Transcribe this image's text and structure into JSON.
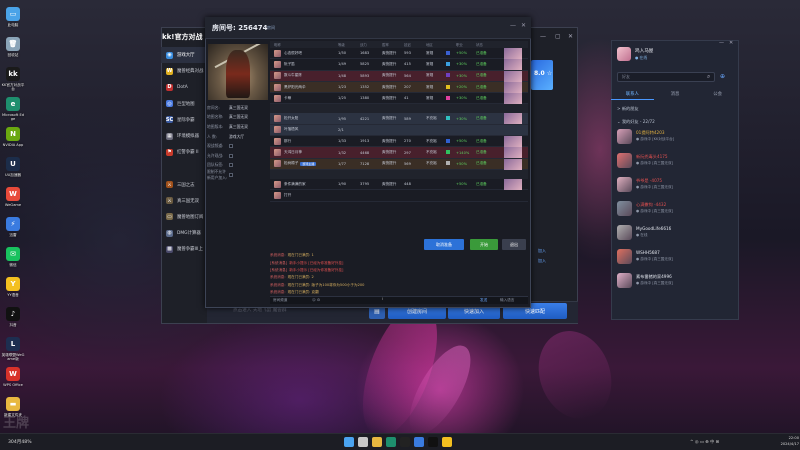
{
  "desktop": {
    "icons": [
      {
        "label": "此电脑",
        "color": "#4aa3e8",
        "glyph": "▭"
      },
      {
        "label": "回收站",
        "color": "#8aa4b8",
        "glyph": "🗑"
      },
      {
        "label": "KK官方对战平台",
        "color": "#1a1a1a",
        "glyph": "kk"
      },
      {
        "label": "Microsoft Edge",
        "color": "#1e8f6e",
        "glyph": "e"
      },
      {
        "label": "NVIDIA App",
        "color": "#6aa810",
        "glyph": "N"
      },
      {
        "label": "UU加速器",
        "color": "#1c2d4a",
        "glyph": "U"
      },
      {
        "label": "WeGame",
        "color": "#e84a3a",
        "glyph": "W"
      },
      {
        "label": "迅雷",
        "color": "#3a7be0",
        "glyph": "⚡"
      },
      {
        "label": "微信",
        "color": "#19c25f",
        "glyph": "✉"
      },
      {
        "label": "YY语音",
        "color": "#f4c020",
        "glyph": "Y"
      },
      {
        "label": "抖音",
        "color": "#111111",
        "glyph": "♪"
      },
      {
        "label": "英雄联盟WeGame版",
        "color": "#1d2e50",
        "glyph": "L"
      },
      {
        "label": "WPS Office",
        "color": "#d8322a",
        "glyph": "W"
      },
      {
        "label": "新建文件夹",
        "color": "#e8b840",
        "glyph": "▬"
      }
    ],
    "watermark": "王牌"
  },
  "kk": {
    "logo": "kk!官方对战",
    "nav": [
      {
        "label": "游戏大厅",
        "color": "#3a8ee0",
        "glyph": "◉"
      },
      {
        "label": "魔兽经典对战",
        "color": "#e0b020",
        "glyph": "W"
      },
      {
        "label": "DotA",
        "color": "#c03030",
        "glyph": "D"
      },
      {
        "label": "巨型地图",
        "color": "#4a7ae0",
        "glyph": "◎"
      },
      {
        "label": "星际争霸",
        "color": "#3a5aa0",
        "glyph": "SC"
      },
      {
        "label": "环境模拟器",
        "color": "#6a6a7a",
        "glyph": "▦"
      },
      {
        "label": "红警争霸 II",
        "color": "#c83a2a",
        "glyph": "⚑"
      },
      {
        "label": "",
        "color": "#333",
        "glyph": ""
      },
      {
        "label": "三国之志",
        "color": "#a0501a",
        "glyph": "⚔"
      },
      {
        "label": "真三国无双",
        "color": "#6a5a40",
        "glyph": "⚔"
      },
      {
        "label": "魔兽地图订阅",
        "color": "#7a6a4a",
        "glyph": "▭"
      },
      {
        "label": "DMG计算器",
        "color": "#5a6a8a",
        "glyph": "◍"
      },
      {
        "label": "魔兽争霸III上",
        "color": "#4a4a6a",
        "glyph": "▩"
      }
    ],
    "search_placeholder": "点击进入 天地飞鼠 魔兽群",
    "btn_create": "创建房间",
    "btn_quick": "快速加入",
    "btn_match": "快速匹配",
    "right_labels": [
      "8.0 ☆",
      "加入",
      "加入"
    ]
  },
  "room": {
    "title": "房间号: 256474",
    "subtitle": "房间",
    "info": [
      {
        "k": "房间名:",
        "v": "真三国无双"
      },
      {
        "k": "地图名称:",
        "v": "真三国无双"
      },
      {
        "k": "地图版本:",
        "v": "真三国无双"
      },
      {
        "k": "人    数:",
        "v": "游戏大厅"
      },
      {
        "k": "观战频道:",
        "v": ""
      },
      {
        "k": "允许观战:",
        "v": ""
      },
      {
        "k": "团队标签:",
        "v": ""
      },
      {
        "k": "限制不允许新用户加入:",
        "v": ""
      }
    ],
    "columns": [
      "昵称",
      "等级",
      "战力",
      "胜率",
      "延迟",
      "地区",
      "",
      "职业",
      "状态",
      "",
      ""
    ],
    "team1_label": "",
    "team2_label": "",
    "players": [
      {
        "name": "心态很好吧",
        "tag": "",
        "a": "1/50",
        "b": "1683",
        "c": "爽快提升",
        "d": "593",
        "e": "常规",
        "col": "#3a60d0",
        "pct": "+50%",
        "stat": "已准备",
        "style": ""
      },
      {
        "name": "阮子笛",
        "tag": "",
        "a": "1/49",
        "b": "5825",
        "c": "爽快提升",
        "d": "415",
        "e": "常规",
        "col": "#3aa0e0",
        "pct": "+30%",
        "stat": "已准备",
        "style": ""
      },
      {
        "name": "数斗牛星陈",
        "tag": "",
        "a": "1/48",
        "b": "5893",
        "c": "爽快提升",
        "d": "564",
        "e": "常规",
        "col": "#7040c0",
        "pct": "+30%",
        "stat": "已准备",
        "style": "red"
      },
      {
        "name": "黑炉阳光两伞",
        "tag": "",
        "a": "1/23",
        "b": "1352",
        "c": "爽快提升",
        "d": "207",
        "e": "常规",
        "col": "#e0c020",
        "pct": "+20%",
        "stat": "已准备",
        "style": "brown"
      },
      {
        "name": "卡蒂",
        "tag": "",
        "a": "1/25",
        "b": "1380",
        "c": "爽快提升",
        "d": "41",
        "e": "常规",
        "col": "#e040a0",
        "pct": "+30%",
        "stat": "已准备",
        "style": ""
      },
      {
        "name": "松开太阳",
        "tag": "",
        "a": "1/95",
        "b": "4221",
        "c": "爽快提升",
        "d": "589",
        "e": "不充裕",
        "col": "#30c0c0",
        "pct": "+30%",
        "stat": "已准备",
        "style": "hl"
      },
      {
        "name": "叶落梧风",
        "tag": "",
        "a": "2/1",
        "b": "",
        "c": "",
        "d": "",
        "e": "",
        "col": "",
        "pct": "",
        "stat": "",
        "style": "hl"
      },
      {
        "name": "那行",
        "tag": "",
        "a": "1/33",
        "b": "1913",
        "c": "爽快提升",
        "d": "270",
        "e": "不充裕",
        "col": "#3060d0",
        "pct": "+50%",
        "stat": "已准备",
        "style": ""
      },
      {
        "name": "天鸿日月神",
        "tag": "",
        "a": "1/32",
        "b": "4468",
        "c": "爽快提升",
        "d": "297",
        "e": "不充裕",
        "col": "#30c060",
        "pct": "+140%",
        "stat": "已准备",
        "style": "red"
      },
      {
        "name": "松树棉子",
        "tag": "游戏主播",
        "a": "1/77",
        "b": "7128",
        "c": "爽快提升",
        "d": "569",
        "e": "不充裕",
        "col": "#b0b0b0",
        "pct": "+50%",
        "stat": "已准备",
        "style": "brown"
      },
      {
        "name": "条件满满的家",
        "tag": "",
        "a": "1/90",
        "b": "3795",
        "c": "爽快提升",
        "d": "448",
        "e": "",
        "col": "",
        "pct": "+50%",
        "stat": "已准备",
        "style": ""
      },
      {
        "name": "打开",
        "tag": "",
        "a": "",
        "b": "",
        "c": "",
        "d": "",
        "e": "",
        "col": "",
        "pct": "",
        "stat": "",
        "style": ""
      }
    ],
    "btn_cancel": "取消准备",
    "btn_start": "开始",
    "btn_leave": "退出",
    "chat": [
      {
        "sys": "系统消息:",
        "text": "现在门已满员: 1",
        "color": "#d8b060"
      },
      {
        "sys": "[系统消息]",
        "text": "新手小提示 [已经为你准备好外挂]",
        "color": "#e05050"
      },
      {
        "sys": "[系统消息]",
        "text": "新手小提示 [已经为你准备好外挂]",
        "color": "#e05050"
      },
      {
        "sys": "系统消息:",
        "text": "现在门已满员: 2",
        "color": "#d8b060"
      },
      {
        "sys": "系统消息:",
        "text": "现在门已满员: 版子为100将你为500小于为200",
        "color": "#d8b060"
      },
      {
        "sys": "系统消息:",
        "text": "现在门已满员: 克翻",
        "color": "#d8b060"
      },
      {
        "sys": "系统消息:",
        "text": "松树棉子: 克翻",
        "color": "#d8b060"
      }
    ],
    "input_channel": "房间频道",
    "input_send": "发送",
    "input_hint": "输入语言"
  },
  "panel": {
    "user_name": "鸡入马屋",
    "user_status": "● 在线",
    "search_placeholder": "好友",
    "tabs": [
      "联系人",
      "消息",
      "公会"
    ],
    "group1": "> 新的朋友",
    "group2": "⌄ 我的好友 - 22/72",
    "friends": [
      {
        "name": "01提阿特4203",
        "status": "● 游戏中 [KK对战平台]",
        "color": "#d8a0b8",
        "nameColor": "#e0b040"
      },
      {
        "name": "新阮兜毒头4175",
        "status": "● 游戏中 [真三国无双]",
        "color": "#e07070",
        "nameColor": "#e05050"
      },
      {
        "name": "爷爷是 -4075",
        "status": "● 游戏中 [真三国无双]",
        "color": "#e0b0c0",
        "nameColor": "#e05050"
      },
      {
        "name": "心满撒钩 -4432",
        "status": "● 游戏中 [真三国无双]",
        "color": "#8090a0",
        "nameColor": "#e05050"
      },
      {
        "name": "MyGoodLife6616",
        "status": "● 在线",
        "color": "#b0b0b0",
        "nameColor": "#e0e4ec"
      },
      {
        "name": "WSHH5687",
        "status": "● 游戏中 [真三国无双]",
        "color": "#e07060",
        "nameColor": "#e0e4ec"
      },
      {
        "name": "素布番猪的家4996",
        "status": "● 游戏中 [真三国无双]",
        "color": "#e0b0c8",
        "nameColor": "#e0e4ec"
      }
    ]
  },
  "taskbar": {
    "left_text": "304月48%",
    "icons": [
      {
        "name": "windows-icon",
        "color": "#4aa3f0"
      },
      {
        "name": "search-icon",
        "color": "#c8c8c8"
      },
      {
        "name": "explorer-icon",
        "color": "#e8b840"
      },
      {
        "name": "edge-icon",
        "color": "#1e8f6e"
      },
      {
        "name": "kk-icon",
        "color": "#222222"
      },
      {
        "name": "app-icon",
        "color": "#3a7be0"
      },
      {
        "name": "douyin-icon",
        "color": "#111111"
      },
      {
        "name": "yy-icon",
        "color": "#f4c020"
      }
    ],
    "tray": "^  ◎  ▭  ⊕  中  ⊞",
    "time": "22:00",
    "date": "2024/4/17"
  }
}
